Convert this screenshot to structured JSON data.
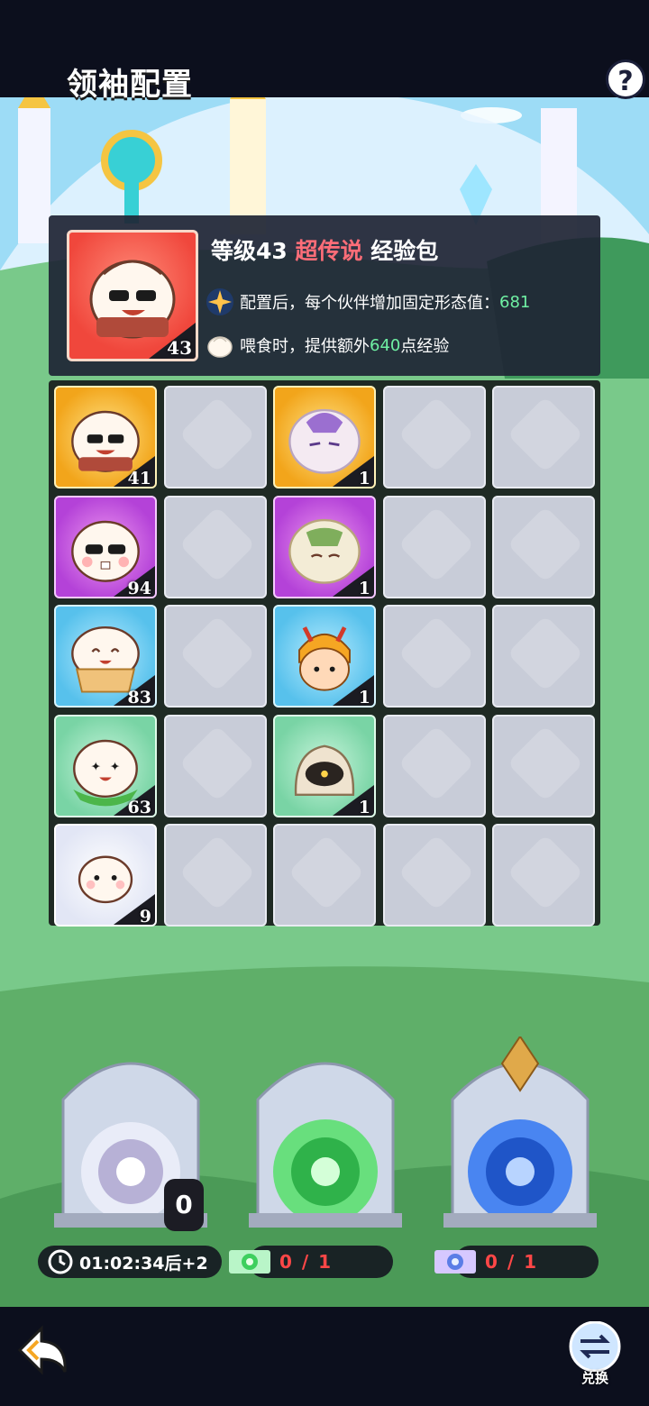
{
  "header": {
    "title": "领袖配置",
    "help_label": "?"
  },
  "info": {
    "card_level": "43",
    "title_prefix": "等级43",
    "title_rarity": "超传说",
    "title_suffix": "经验包",
    "line1_text": "配置后，每个伙伴增加固定形态值：",
    "line1_value": "681",
    "line2_prefix": "喂食时，提供额外",
    "line2_value": "640",
    "line2_suffix": "点经验"
  },
  "grid": {
    "rows": [
      [
        {
          "rarity": "gold",
          "icon": "bun-sunglasses-icon",
          "count": "41"
        },
        {
          "rarity": "empty"
        },
        {
          "rarity": "gold",
          "icon": "dragon-bun-icon",
          "count": "1"
        },
        {
          "rarity": "empty"
        },
        {
          "rarity": "empty"
        }
      ],
      [
        {
          "rarity": "purple",
          "icon": "bun-cool-icon",
          "count": "94"
        },
        {
          "rarity": "empty"
        },
        {
          "rarity": "purple",
          "icon": "frog-bun-icon",
          "count": "1"
        },
        {
          "rarity": "empty"
        },
        {
          "rarity": "empty"
        }
      ],
      [
        {
          "rarity": "blue",
          "icon": "bun-happy-icon",
          "count": "83"
        },
        {
          "rarity": "empty"
        },
        {
          "rarity": "blue",
          "icon": "warrior-icon",
          "count": "1"
        },
        {
          "rarity": "empty"
        },
        {
          "rarity": "empty"
        }
      ],
      [
        {
          "rarity": "green",
          "icon": "bun-leaf-icon",
          "count": "63"
        },
        {
          "rarity": "empty"
        },
        {
          "rarity": "green",
          "icon": "ghost-bun-icon",
          "count": "1"
        },
        {
          "rarity": "empty"
        },
        {
          "rarity": "empty"
        }
      ],
      [
        {
          "rarity": "white",
          "icon": "bun-small-icon",
          "count": "9"
        },
        {
          "rarity": "empty"
        },
        {
          "rarity": "empty"
        },
        {
          "rarity": "empty"
        },
        {
          "rarity": "empty"
        }
      ]
    ]
  },
  "portals": {
    "free_count": "0",
    "timer": "01:02:34后+2",
    "green_ticket": "0 / 1",
    "blue_ticket": "0 / 1"
  },
  "bottom": {
    "exchange_label": "兑换"
  },
  "colors": {
    "legend_red": "#ff6d78",
    "value_green": "#6ff0a3",
    "ticket_red": "#ff4747"
  }
}
